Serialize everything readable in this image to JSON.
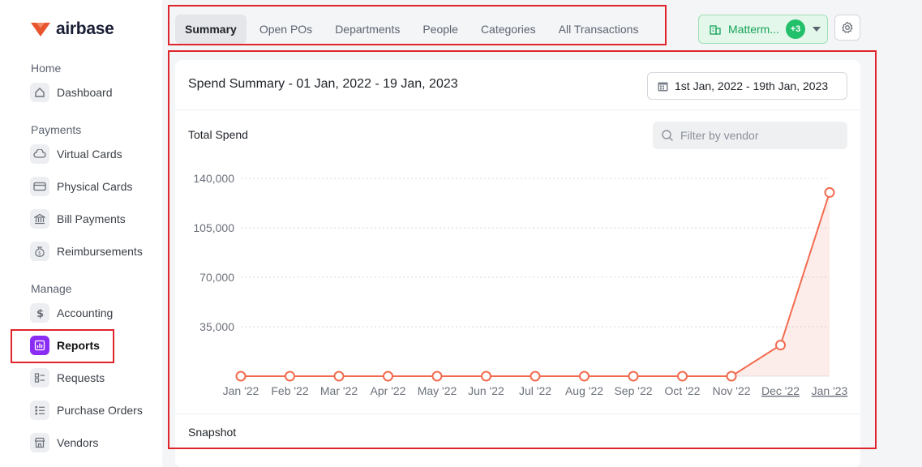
{
  "brand": {
    "name": "airbase",
    "accent": "#e8542e"
  },
  "sidebar": {
    "sections": [
      {
        "label": "Home"
      },
      {
        "label": "Payments"
      },
      {
        "label": "Manage"
      }
    ],
    "items": [
      {
        "label": "Dashboard",
        "icon": "home-icon"
      },
      {
        "label": "Virtual Cards",
        "icon": "cloud-icon"
      },
      {
        "label": "Physical Cards",
        "icon": "card-icon"
      },
      {
        "label": "Bill Payments",
        "icon": "bank-icon"
      },
      {
        "label": "Reimbursements",
        "icon": "money-bag-icon"
      },
      {
        "label": "Accounting",
        "icon": "dollar-icon"
      },
      {
        "label": "Reports",
        "icon": "bar-chart-icon",
        "active": true
      },
      {
        "label": "Requests",
        "icon": "requests-icon"
      },
      {
        "label": "Purchase Orders",
        "icon": "list-icon"
      },
      {
        "label": "Vendors",
        "icon": "store-icon"
      }
    ]
  },
  "tabs": [
    {
      "label": "Summary",
      "active": true
    },
    {
      "label": "Open POs"
    },
    {
      "label": "Departments"
    },
    {
      "label": "People"
    },
    {
      "label": "Categories"
    },
    {
      "label": "All Transactions"
    }
  ],
  "entity": {
    "name": "Matterm...",
    "badge": "+3",
    "color": "#22c06b"
  },
  "card": {
    "title": "Spend Summary - 01 Jan, 2022 - 19 Jan, 2023",
    "date_range": "1st Jan, 2022 - 19th Jan, 2023",
    "total_label": "Total Spend",
    "filter_placeholder": "Filter by vendor",
    "snapshot_label": "Snapshot"
  },
  "chart_data": {
    "type": "area",
    "categories": [
      "Jan '22",
      "Feb '22",
      "Mar '22",
      "Apr '22",
      "May '22",
      "Jun '22",
      "Jul '22",
      "Aug '22",
      "Sep '22",
      "Oct '22",
      "Nov '22",
      "Dec '22",
      "Jan '23"
    ],
    "underlined_categories": [
      "Dec '22",
      "Jan '23"
    ],
    "series": [
      {
        "values": [
          0,
          0,
          0,
          0,
          0,
          0,
          0,
          0,
          0,
          0,
          0,
          22000,
          130000
        ],
        "color": "#f26b4f"
      }
    ],
    "yticks": [
      35000,
      70000,
      105000,
      140000
    ],
    "ytick_labels": [
      "35,000",
      "70,000",
      "105,000",
      "140,000"
    ],
    "ylim": [
      0,
      140000
    ],
    "grid": true,
    "xlabel": "",
    "ylabel": ""
  }
}
